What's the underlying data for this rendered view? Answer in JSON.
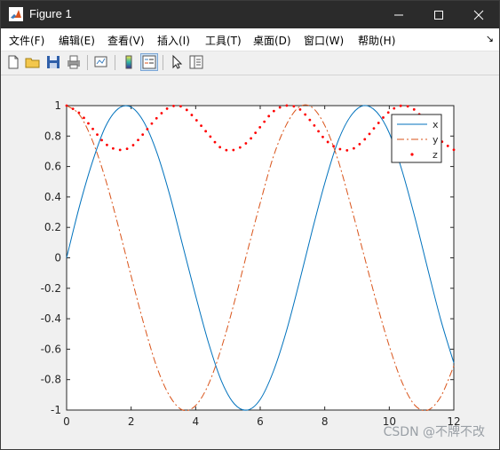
{
  "window": {
    "title": "Figure 1",
    "icon": "matlab-icon",
    "controls": [
      "minimize-icon",
      "maximize-icon",
      "close-icon"
    ]
  },
  "menu": {
    "items": [
      "文件(F)",
      "编辑(E)",
      "查看(V)",
      "插入(I)",
      "工具(T)",
      "桌面(D)",
      "窗口(W)",
      "帮助(H)"
    ],
    "overflow_icon": "chevron-icon"
  },
  "toolbar": {
    "buttons": [
      "new-figure-icon",
      "open-file-icon",
      "save-icon",
      "print-icon",
      "link-plot-icon",
      "insert-colorbar-icon",
      "insert-legend-icon",
      "edit-plot-icon",
      "property-inspector-icon"
    ]
  },
  "chart_data": {
    "type": "line",
    "title": "",
    "xlabel": "",
    "ylabel": "",
    "xlim": [
      0,
      12
    ],
    "ylim": [
      -1,
      1
    ],
    "xticks": [
      "0",
      "2",
      "4",
      "6",
      "8",
      "10",
      "12"
    ],
    "yticks": [
      "1",
      "0.8",
      "0.6",
      "0.4",
      "0.2",
      "0",
      "-0.2",
      "-0.4",
      "-0.6",
      "-0.8",
      "-1"
    ],
    "grid": false,
    "legend": {
      "placement": "top-right",
      "entries": [
        {
          "label": "x",
          "color": "#0072bd",
          "style": "solid"
        },
        {
          "label": "y",
          "color": "#d95319",
          "style": "dash-dot"
        },
        {
          "label": "z",
          "color": "#ff0000",
          "style": "dots"
        }
      ]
    },
    "x": [
      0,
      0.4,
      0.8,
      1.2,
      1.6,
      2.0,
      2.4,
      2.8,
      3.2,
      3.6,
      4.0,
      4.4,
      4.8,
      5.2,
      5.6,
      6.0,
      6.4,
      6.8,
      7.2,
      7.6,
      8.0,
      8.4,
      8.8,
      9.2,
      9.6,
      10.0,
      10.4,
      10.8,
      11.2,
      11.6,
      12.0
    ],
    "series": [
      {
        "name": "x",
        "values": [
          0,
          0.34,
          0.63,
          0.86,
          0.98,
          0.99,
          0.89,
          0.69,
          0.41,
          0.08,
          -0.25,
          -0.56,
          -0.81,
          -0.96,
          -1.0,
          -0.93,
          -0.75,
          -0.49,
          -0.17,
          0.17,
          0.49,
          0.76,
          0.93,
          1.0,
          0.96,
          0.82,
          0.57,
          0.26,
          -0.08,
          -0.41,
          -0.69
        ]
      },
      {
        "name": "y",
        "values": [
          1.0,
          0.94,
          0.77,
          0.52,
          0.21,
          -0.12,
          -0.44,
          -0.72,
          -0.91,
          -1.0,
          -0.97,
          -0.83,
          -0.59,
          -0.29,
          0.04,
          0.36,
          0.66,
          0.87,
          0.99,
          0.99,
          0.87,
          0.65,
          0.35,
          0.03,
          -0.29,
          -0.58,
          -0.82,
          -0.97,
          -1.0,
          -0.91,
          -0.71
        ]
      },
      {
        "name": "z",
        "values": [
          1.0,
          0.95,
          0.85,
          0.75,
          0.71,
          0.73,
          0.82,
          0.92,
          0.99,
          0.99,
          0.91,
          0.81,
          0.72,
          0.71,
          0.76,
          0.86,
          0.96,
          1.0,
          0.98,
          0.89,
          0.78,
          0.72,
          0.71,
          0.77,
          0.87,
          0.96,
          1.0,
          0.97,
          0.87,
          0.77,
          0.71
        ]
      }
    ]
  },
  "watermark": "CSDN @不牌不改"
}
